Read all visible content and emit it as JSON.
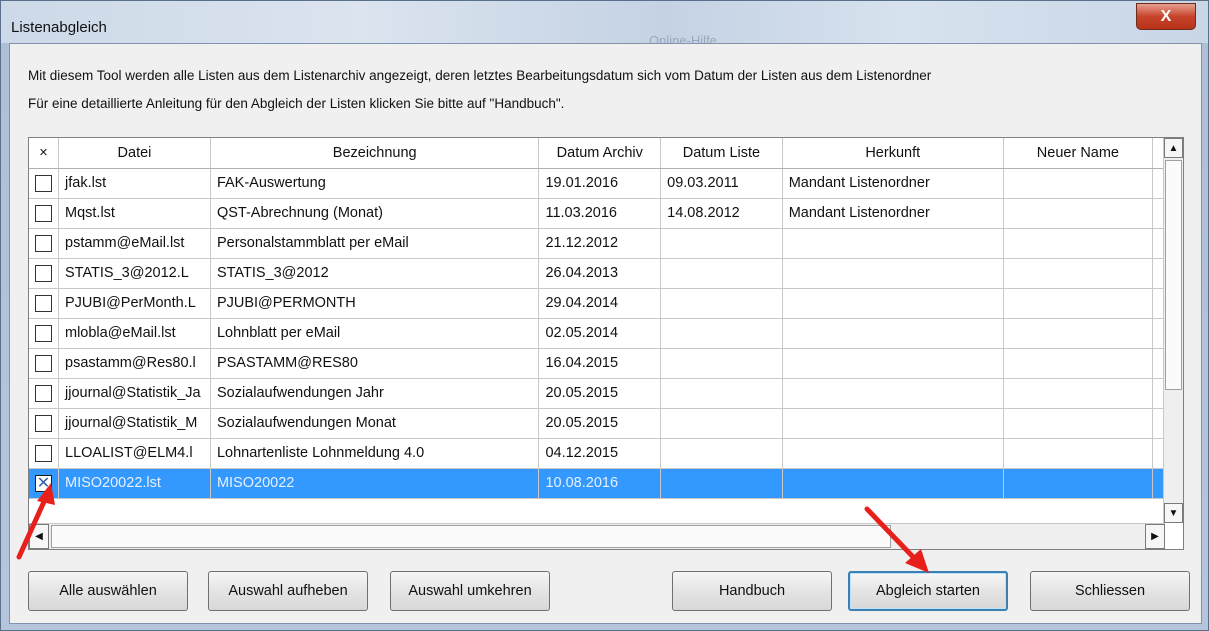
{
  "window": {
    "title": "Listenabgleich",
    "background_caption": "Online-Hilfe",
    "close_symbol": "X"
  },
  "description": {
    "line1": "Mit diesem Tool werden alle Listen aus dem Listenarchiv angezeigt, deren letztes Bearbeitungsdatum sich vom Datum der Listen aus dem Listenordner",
    "line2": "Für eine detaillierte Anleitung für den Abgleich der Listen klicken Sie bitte auf \"Handbuch\"."
  },
  "table": {
    "columns": [
      "×",
      "Datei",
      "Bezeichnung",
      "Datum Archiv",
      "Datum Liste",
      "Herkunft",
      "Neuer Name",
      ""
    ],
    "rows": [
      {
        "checked": false,
        "datei": "jfak.lst",
        "bezeichnung": "FAK-Auswertung",
        "datum_archiv": "19.01.2016",
        "datum_liste": "09.03.2011",
        "herkunft": "Mandant Listenordner",
        "neuer_name": "",
        "extra": "M"
      },
      {
        "checked": false,
        "datei": "Mqst.lst",
        "bezeichnung": "QST-Abrechnung (Monat)",
        "datum_archiv": "11.03.2016",
        "datum_liste": "14.08.2012",
        "herkunft": "Mandant Listenordner",
        "neuer_name": "",
        "extra": "M"
      },
      {
        "checked": false,
        "datei": "pstamm@eMail.lst",
        "bezeichnung": "Personalstammblatt per eMail",
        "datum_archiv": "21.12.2012",
        "datum_liste": "",
        "herkunft": "",
        "neuer_name": "",
        "extra": "E"
      },
      {
        "checked": false,
        "datei": "STATIS_3@2012.L",
        "bezeichnung": "STATIS_3@2012",
        "datum_archiv": "26.04.2013",
        "datum_liste": "",
        "herkunft": "",
        "neuer_name": "",
        "extra": "E"
      },
      {
        "checked": false,
        "datei": "PJUBI@PerMonth.L",
        "bezeichnung": "PJUBI@PERMONTH",
        "datum_archiv": "29.04.2014",
        "datum_liste": "",
        "herkunft": "",
        "neuer_name": "",
        "extra": "E"
      },
      {
        "checked": false,
        "datei": "mlobla@eMail.lst",
        "bezeichnung": "Lohnblatt per eMail",
        "datum_archiv": "02.05.2014",
        "datum_liste": "",
        "herkunft": "",
        "neuer_name": "",
        "extra": "E"
      },
      {
        "checked": false,
        "datei": "psastamm@Res80.l",
        "bezeichnung": "PSASTAMM@RES80",
        "datum_archiv": "16.04.2015",
        "datum_liste": "",
        "herkunft": "",
        "neuer_name": "",
        "extra": "E"
      },
      {
        "checked": false,
        "datei": "jjournal@Statistik_Ja",
        "bezeichnung": "Sozialaufwendungen Jahr",
        "datum_archiv": "20.05.2015",
        "datum_liste": "",
        "herkunft": "",
        "neuer_name": "",
        "extra": "E"
      },
      {
        "checked": false,
        "datei": "jjournal@Statistik_M",
        "bezeichnung": "Sozialaufwendungen Monat",
        "datum_archiv": "20.05.2015",
        "datum_liste": "",
        "herkunft": "",
        "neuer_name": "",
        "extra": "E"
      },
      {
        "checked": false,
        "datei": "LLOALIST@ELM4.l",
        "bezeichnung": "Lohnartenliste Lohnmeldung 4.0",
        "datum_archiv": "04.12.2015",
        "datum_liste": "",
        "herkunft": "",
        "neuer_name": "",
        "extra": "E"
      },
      {
        "checked": true,
        "datei": "MISO20022.lst",
        "bezeichnung": "MISO20022",
        "datum_archiv": "10.08.2016",
        "datum_liste": "",
        "herkunft": "",
        "neuer_name": "",
        "extra": "I",
        "selected": true
      }
    ]
  },
  "buttons": {
    "select_all": "Alle auswählen",
    "clear_selection": "Auswahl aufheben",
    "invert_selection": "Auswahl umkehren",
    "manual": "Handbuch",
    "start_compare": "Abgleich starten",
    "close": "Schliessen"
  },
  "colors": {
    "selection": "#3399ff",
    "annotation_arrow": "#e8201c"
  }
}
